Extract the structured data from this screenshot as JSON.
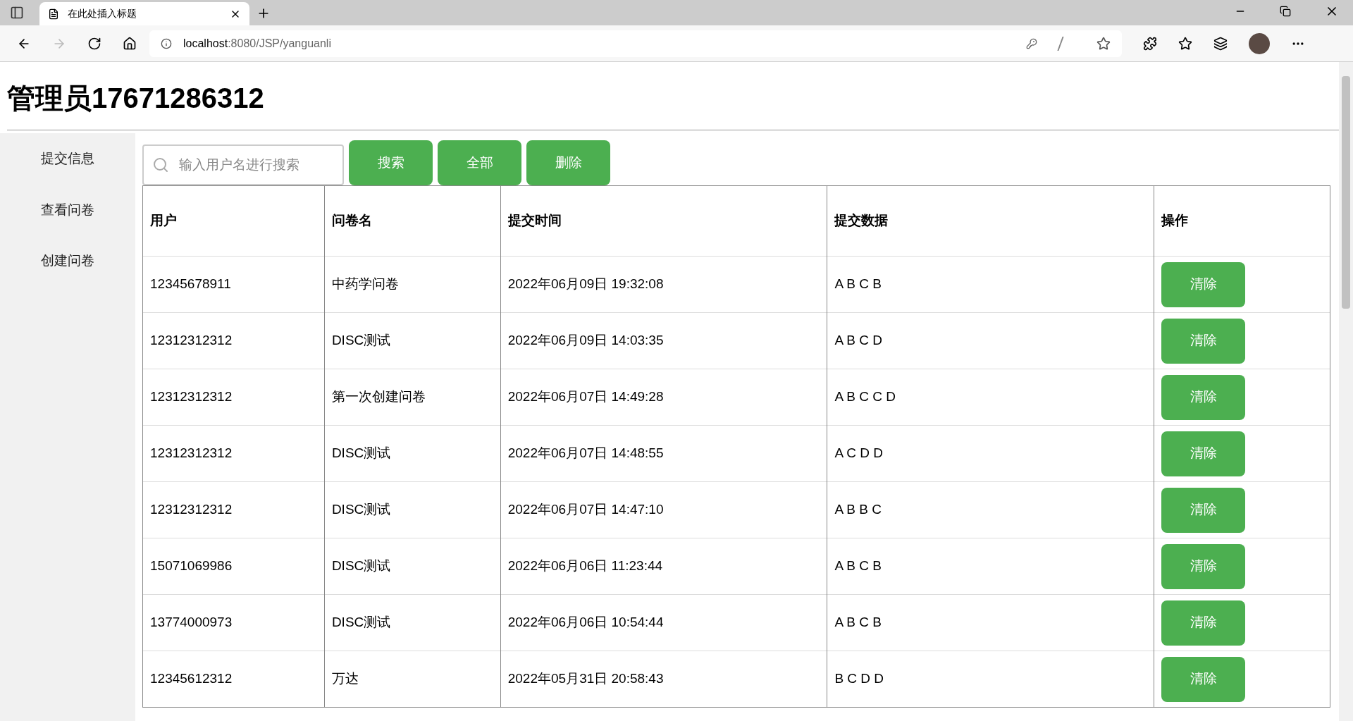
{
  "browser": {
    "tab_title": "在此处插入标题",
    "url_host": "localhost",
    "url_path": ":8080/JSP/yanguanli"
  },
  "page_title": "管理员17671286312",
  "sidebar": {
    "items": [
      {
        "label": "提交信息"
      },
      {
        "label": "查看问卷"
      },
      {
        "label": "创建问卷"
      }
    ]
  },
  "toolbar": {
    "search": {
      "placeholder": "输入用户名进行搜索"
    },
    "buttons": [
      "搜索",
      "全部",
      "删除"
    ]
  },
  "table": {
    "columns": [
      "用户",
      "问卷名",
      "提交时间",
      "提交数据",
      "操作"
    ],
    "rows": [
      {
        "user": "12345678911",
        "survey": "中药学问卷",
        "time": "2022年06月09日 19:32:08",
        "data": "A B C B",
        "action": "清除"
      },
      {
        "user": "12312312312",
        "survey": "DISC测试",
        "time": "2022年06月09日 14:03:35",
        "data": "A B C D",
        "action": "清除"
      },
      {
        "user": "12312312312",
        "survey": "第一次创建问卷",
        "time": "2022年06月07日 14:49:28",
        "data": "A B C C D",
        "action": "清除"
      },
      {
        "user": "12312312312",
        "survey": "DISC测试",
        "time": "2022年06月07日 14:48:55",
        "data": "A C D D",
        "action": "清除"
      },
      {
        "user": "12312312312",
        "survey": "DISC测试",
        "time": "2022年06月07日 14:47:10",
        "data": "A B B C",
        "action": "清除"
      },
      {
        "user": "15071069986",
        "survey": "DISC测试",
        "time": "2022年06月06日 11:23:44",
        "data": "A B C B",
        "action": "清除"
      },
      {
        "user": "13774000973",
        "survey": "DISC测试",
        "time": "2022年06月06日 10:54:44",
        "data": "A B C B",
        "action": "清除"
      },
      {
        "user": "12345612312",
        "survey": "万达",
        "time": "2022年05月31日 20:58:43",
        "data": "B C D D",
        "action": "清除"
      }
    ]
  }
}
